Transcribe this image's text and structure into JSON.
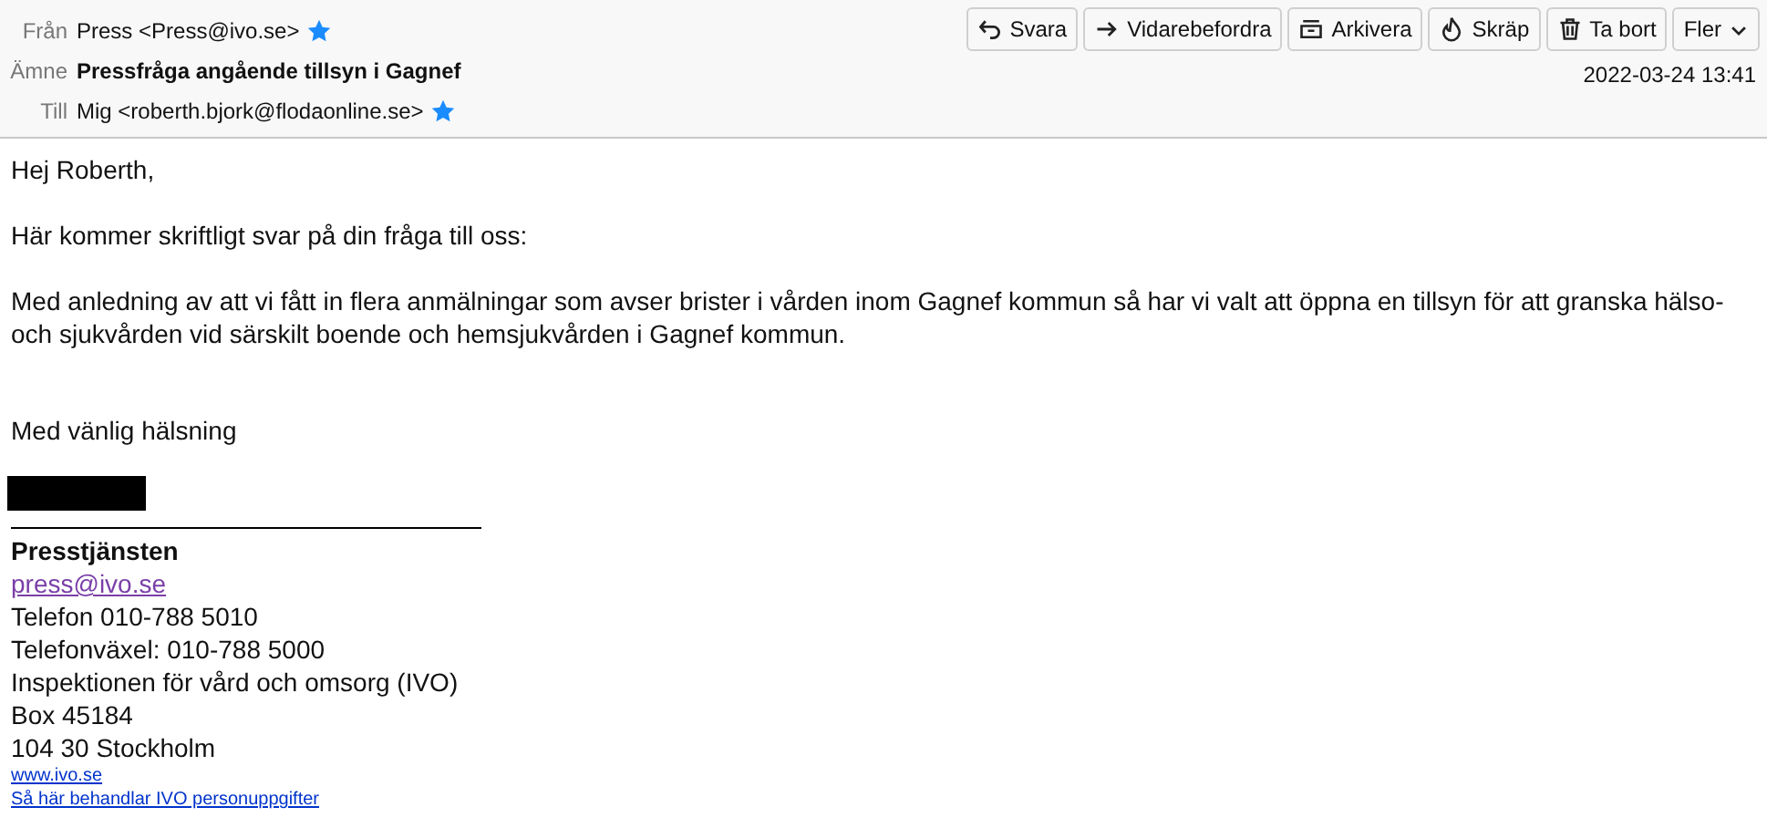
{
  "header": {
    "fields": [
      {
        "label": "Från",
        "value": "Press <Press@ivo.se>",
        "starred": true,
        "kind": "contact"
      },
      {
        "label": "Ämne",
        "value": "Pressfråga angående tillsyn i Gagnef",
        "kind": "subject"
      },
      {
        "label": "Till",
        "value": "Mig <roberth.bjork@flodaonline.se>",
        "starred": true,
        "kind": "contact"
      }
    ],
    "buttons": [
      {
        "label": "Svara",
        "kind": "reply"
      },
      {
        "label": "Vidarebefordra",
        "kind": "forward"
      },
      {
        "label": "Arkivera",
        "kind": "archive"
      },
      {
        "label": "Skräp",
        "kind": "junk"
      },
      {
        "label": "Ta bort",
        "kind": "delete"
      },
      {
        "label": "Fler",
        "kind": "more"
      }
    ],
    "date": "2022-03-24 13:41"
  },
  "body": {
    "paragraphs": [
      "Hej Roberth,",
      "Här kommer skriftligt svar på din fråga till oss:",
      "Med anledning av att vi fått in flera anmälningar som avser brister i vården inom Gagnef kommun så har vi valt att öppna en tillsyn för att granska hälso- och sjukvården vid särskilt boende och hemsjukvården i Gagnef kommun."
    ],
    "closing": "Med vänlig hälsning",
    "redacted": true,
    "signature": [
      {
        "text": "Presstjänsten",
        "kind": "bold"
      },
      {
        "text": "press@ivo.se",
        "kind": "link"
      },
      {
        "text": "Telefon 010-788 5010",
        "kind": "text"
      },
      {
        "text": "Telefonväxel: 010-788 5000",
        "kind": "text"
      },
      {
        "text": "Inspektionen för vård och omsorg (IVO)",
        "kind": "text"
      },
      {
        "text": "Box 45184",
        "kind": "text"
      },
      {
        "text": "104 30 Stockholm",
        "kind": "text"
      },
      {
        "text": "www.ivo.se",
        "kind": "small-link"
      },
      {
        "text": "Så här behandlar IVO personuppgifter",
        "kind": "small-link"
      }
    ]
  }
}
